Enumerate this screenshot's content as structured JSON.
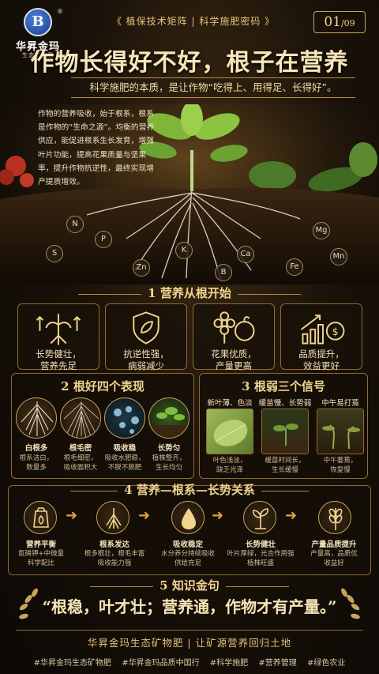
{
  "header": {
    "logo_letter": "B",
    "logo_reg": "®",
    "brand_name": "华昇金玛",
    "brand_sub": "生态矿物肥",
    "tagline": "《 植保技术矩阵 | 科学施肥密码 》",
    "page_current": "01",
    "page_total": "/09"
  },
  "title": "作物长得好不好，根子在营养",
  "subtitle": "科学施肥的本质，是让作物“吃得上、用得足、长得好”。",
  "intro": "作物的营养吸收，始于根系，根系是作物的“生命之源”。均衡的营养供应，能促进根系生长发育，增强叶片功能，提高花果质量与坚果率，提升作物抗逆性，最终实现增产提质增效。",
  "nutrients": [
    "N",
    "P",
    "K",
    "S",
    "Zn",
    "B",
    "Ca",
    "Fe",
    "Mg",
    "Mn"
  ],
  "section1": {
    "title": "1 营养从根开始",
    "cards": [
      {
        "icon": "root-growth-icon",
        "text": "长势健壮，\n营养先足"
      },
      {
        "icon": "shield-leaf-icon",
        "text": "抗逆性强，\n病弱减少"
      },
      {
        "icon": "flower-fruit-icon",
        "text": "花果优质，\n产量更高"
      },
      {
        "icon": "growth-chart-icon",
        "text": "品质提升，\n效益更好"
      }
    ]
  },
  "section2": {
    "title": "2 根好四个表现",
    "items": [
      {
        "label": "白根多",
        "desc": "根系洁白，\n数量多"
      },
      {
        "label": "根毛密",
        "desc": "根毛细密，\n吸收面积大"
      },
      {
        "label": "吸收稳",
        "desc": "吸收水肥稳，\n不脱不脱肥"
      },
      {
        "label": "长势匀",
        "desc": "植株整齐，\n生长均匀"
      }
    ]
  },
  "section3": {
    "title": "3 根弱三个信号",
    "items": [
      {
        "label": "新叶薄、色淡",
        "desc": "叶色浅淡，\n缺乏光泽"
      },
      {
        "label": "缓苗慢、长势弱",
        "desc": "缓苗时间长，\n生长缓慢"
      },
      {
        "label": "中午易打蔫",
        "desc": "中午萎蔫，\n恢复慢"
      }
    ]
  },
  "section4": {
    "title": "4 营养—根系—长势关系",
    "steps": [
      {
        "icon": "fertilizer-bag-icon",
        "label": "营养平衡",
        "desc": "氮磷钾+中微量\n科学配比"
      },
      {
        "icon": "root-icon",
        "label": "根系发达",
        "desc": "根多根壮，根毛丰富\n吸收能力强"
      },
      {
        "icon": "water-drop-icon",
        "label": "吸收稳定",
        "desc": "水分养分持续吸收\n供给充足"
      },
      {
        "icon": "seedling-icon",
        "label": "长势健壮",
        "desc": "叶片厚绿，光合作用强\n植株旺盛"
      },
      {
        "icon": "wheat-icon",
        "label": "产量品质提升",
        "desc": "产量高，品质优\n收益好"
      }
    ]
  },
  "section5": {
    "title": "5 知识金句",
    "quote": "“根稳，叶才壮；营养通，作物才有产量。”"
  },
  "footer": {
    "slogan": "华昇金玛生态矿物肥  |  让矿源营养回归土地",
    "tags": [
      "#华昇金玛生态矿物肥",
      "#华昇金玛品质中国行",
      "#科学施肥",
      "#营养管理",
      "#绿色农业"
    ]
  },
  "colors": {
    "gold": "#e7c27a",
    "accent_arrow": "#e1a33c",
    "background": "#0e0a06"
  }
}
